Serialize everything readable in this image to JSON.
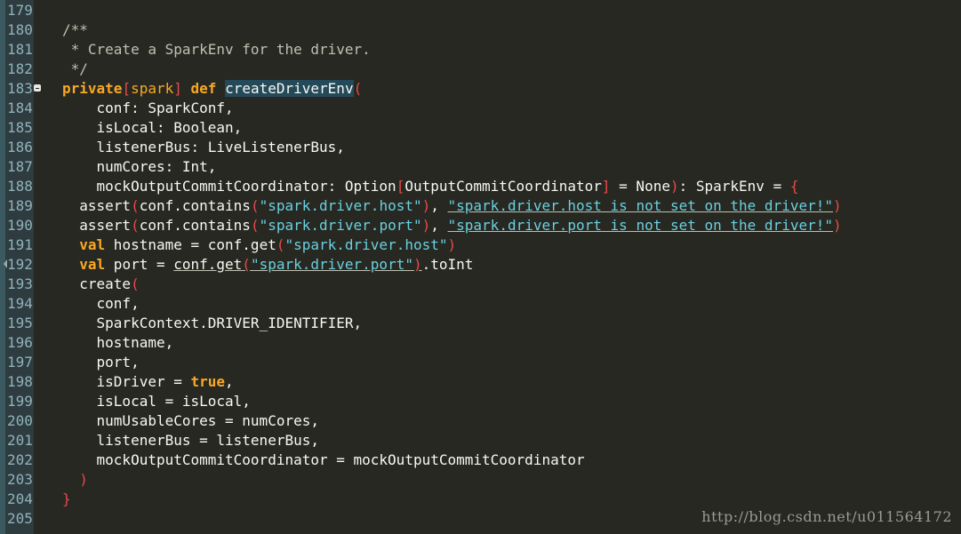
{
  "colors": {
    "background": "#272822",
    "gutter": "#2e3b3f",
    "line_number": "#8fb3ba",
    "keyword": "#f9a825",
    "bracket": "#e84a4a",
    "string": "#6ad0e0",
    "text": "#f8f8f2",
    "comment": "#c0c0b0",
    "highlight": "#244a5a"
  },
  "lines": [
    {
      "n": "179",
      "tokens": []
    },
    {
      "n": "180",
      "tokens": [
        {
          "t": "/**",
          "c": "comment"
        }
      ]
    },
    {
      "n": "181",
      "tokens": [
        {
          "t": " * Create a SparkEnv for the driver.",
          "c": "comment"
        }
      ]
    },
    {
      "n": "182",
      "tokens": [
        {
          "t": " */",
          "c": "comment"
        }
      ]
    },
    {
      "n": "183",
      "fold": true,
      "tokens": [
        {
          "t": "private",
          "c": "kw"
        },
        {
          "t": "[",
          "c": "bracket"
        },
        {
          "t": "spark",
          "c": "mod"
        },
        {
          "t": "]",
          "c": "bracket"
        },
        {
          "t": " ",
          "c": "punc"
        },
        {
          "t": "def",
          "c": "kw"
        },
        {
          "t": " ",
          "c": "punc"
        },
        {
          "t": "createDriverEnv",
          "c": "ident",
          "hl": true
        },
        {
          "t": "(",
          "c": "bracket"
        }
      ]
    },
    {
      "n": "184",
      "tokens": [
        {
          "t": "    conf",
          "c": "ident"
        },
        {
          "t": ": SparkConf,",
          "c": "punc"
        }
      ]
    },
    {
      "n": "185",
      "tokens": [
        {
          "t": "    isLocal",
          "c": "ident"
        },
        {
          "t": ": Boolean,",
          "c": "punc"
        }
      ]
    },
    {
      "n": "186",
      "tokens": [
        {
          "t": "    listenerBus",
          "c": "ident"
        },
        {
          "t": ": LiveListenerBus,",
          "c": "punc"
        }
      ]
    },
    {
      "n": "187",
      "tokens": [
        {
          "t": "    numCores",
          "c": "ident"
        },
        {
          "t": ": Int,",
          "c": "punc"
        }
      ]
    },
    {
      "n": "188",
      "tokens": [
        {
          "t": "    mockOutputCommitCoordinator",
          "c": "ident"
        },
        {
          "t": ": Option",
          "c": "punc"
        },
        {
          "t": "[",
          "c": "bracket"
        },
        {
          "t": "OutputCommitCoordinator",
          "c": "ident"
        },
        {
          "t": "]",
          "c": "bracket"
        },
        {
          "t": " = None",
          "c": "punc"
        },
        {
          "t": ")",
          "c": "bracket"
        },
        {
          "t": ": SparkEnv = ",
          "c": "punc"
        },
        {
          "t": "{",
          "c": "bracket"
        }
      ]
    },
    {
      "n": "189",
      "tokens": [
        {
          "t": "  assert",
          "c": "ident"
        },
        {
          "t": "(",
          "c": "bracket"
        },
        {
          "t": "conf.contains",
          "c": "ident"
        },
        {
          "t": "(",
          "c": "bracket"
        },
        {
          "t": "\"spark.driver.host\"",
          "c": "str"
        },
        {
          "t": ")",
          "c": "bracket"
        },
        {
          "t": ", ",
          "c": "punc"
        },
        {
          "t": "\"spark.driver.host is not set on the driver!\"",
          "c": "str",
          "ul": true
        },
        {
          "t": ")",
          "c": "bracket"
        }
      ]
    },
    {
      "n": "190",
      "tokens": [
        {
          "t": "  assert",
          "c": "ident"
        },
        {
          "t": "(",
          "c": "bracket"
        },
        {
          "t": "conf.contains",
          "c": "ident"
        },
        {
          "t": "(",
          "c": "bracket"
        },
        {
          "t": "\"spark.driver.port\"",
          "c": "str"
        },
        {
          "t": ")",
          "c": "bracket"
        },
        {
          "t": ", ",
          "c": "punc"
        },
        {
          "t": "\"spark.driver.port is not set on the driver!\"",
          "c": "str",
          "ul": true
        },
        {
          "t": ")",
          "c": "bracket"
        }
      ]
    },
    {
      "n": "191",
      "tokens": [
        {
          "t": "  ",
          "c": "punc"
        },
        {
          "t": "val",
          "c": "kw"
        },
        {
          "t": " hostname = conf.get",
          "c": "ident"
        },
        {
          "t": "(",
          "c": "bracket"
        },
        {
          "t": "\"spark.driver.host\"",
          "c": "str"
        },
        {
          "t": ")",
          "c": "bracket"
        }
      ]
    },
    {
      "n": "192",
      "marker": true,
      "tokens": [
        {
          "t": "  ",
          "c": "punc"
        },
        {
          "t": "val",
          "c": "kw"
        },
        {
          "t": " port = ",
          "c": "ident"
        },
        {
          "t": "conf.get",
          "c": "ident",
          "ul": true
        },
        {
          "t": "(",
          "c": "bracket",
          "ul": true
        },
        {
          "t": "\"spark.driver.port\"",
          "c": "str",
          "ul": true
        },
        {
          "t": ")",
          "c": "bracket",
          "ul": true
        },
        {
          "t": ".toInt",
          "c": "ident"
        }
      ]
    },
    {
      "n": "193",
      "tokens": [
        {
          "t": "  create",
          "c": "ident"
        },
        {
          "t": "(",
          "c": "bracket"
        }
      ]
    },
    {
      "n": "194",
      "tokens": [
        {
          "t": "    conf,",
          "c": "ident"
        }
      ]
    },
    {
      "n": "195",
      "tokens": [
        {
          "t": "    SparkContext.DRIVER_IDENTIFIER,",
          "c": "ident"
        }
      ]
    },
    {
      "n": "196",
      "tokens": [
        {
          "t": "    hostname,",
          "c": "ident"
        }
      ]
    },
    {
      "n": "197",
      "tokens": [
        {
          "t": "    port,",
          "c": "ident"
        }
      ]
    },
    {
      "n": "198",
      "tokens": [
        {
          "t": "    isDriver = ",
          "c": "ident"
        },
        {
          "t": "true",
          "c": "kw"
        },
        {
          "t": ",",
          "c": "punc"
        }
      ]
    },
    {
      "n": "199",
      "tokens": [
        {
          "t": "    isLocal = isLocal,",
          "c": "ident"
        }
      ]
    },
    {
      "n": "200",
      "tokens": [
        {
          "t": "    numUsableCores = numCores,",
          "c": "ident"
        }
      ]
    },
    {
      "n": "201",
      "tokens": [
        {
          "t": "    listenerBus = listenerBus,",
          "c": "ident"
        }
      ]
    },
    {
      "n": "202",
      "tokens": [
        {
          "t": "    mockOutputCommitCoordinator = mockOutputCommitCoordinator",
          "c": "ident"
        }
      ]
    },
    {
      "n": "203",
      "tokens": [
        {
          "t": "  ",
          "c": "punc"
        },
        {
          "t": ")",
          "c": "bracket"
        }
      ]
    },
    {
      "n": "204",
      "tokens": [
        {
          "t": "}",
          "c": "bracket"
        }
      ]
    },
    {
      "n": "205",
      "tokens": []
    }
  ],
  "watermark": "http://blog.csdn.net/u011564172"
}
